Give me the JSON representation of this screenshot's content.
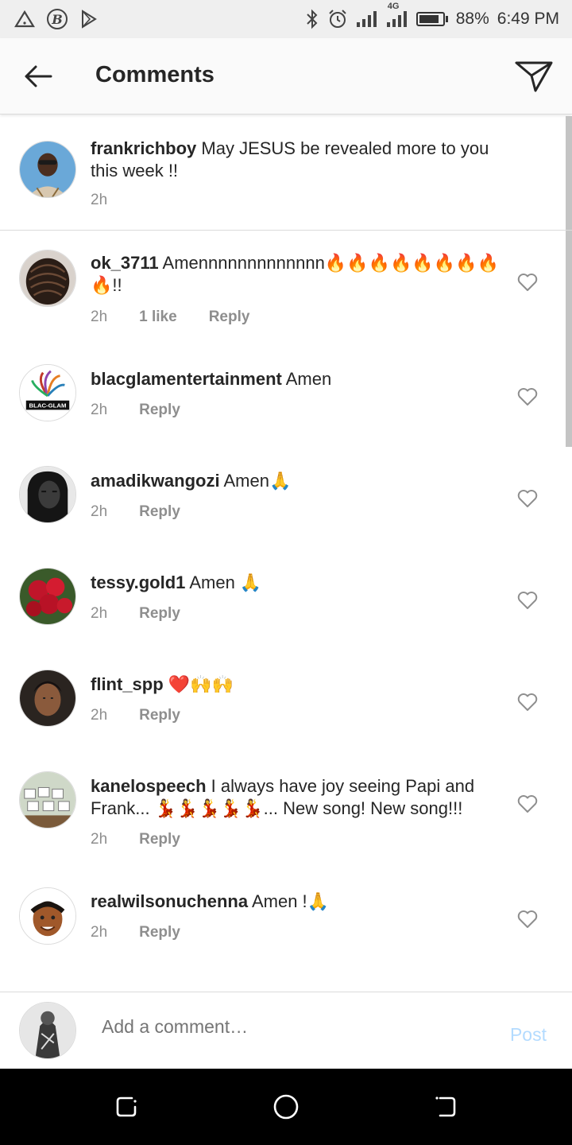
{
  "status_bar": {
    "network_label": "4G",
    "battery": "88%",
    "battery_level": 0.88,
    "time": "6:49 PM",
    "icons": [
      "alert-triangle-icon",
      "b-circle-icon",
      "play-store-icon",
      "bluetooth-icon",
      "alarm-icon",
      "signal-icon",
      "signal-4g-icon",
      "battery-icon"
    ]
  },
  "header": {
    "title": "Comments",
    "back_icon": "arrow-left-icon",
    "send_icon": "paper-plane-icon"
  },
  "caption": {
    "username": "frankrichboy",
    "text": "May JESUS be revealed more to you this week !!",
    "time": "2h"
  },
  "comments": [
    {
      "username": "ok_3711",
      "text": "Amennnnnnnnnnnnn🔥🔥🔥🔥🔥🔥🔥🔥🔥!!",
      "time": "2h",
      "likes": "1 like",
      "reply": "Reply"
    },
    {
      "username": "blacglamentertainment",
      "text": "Amen",
      "time": "2h",
      "reply": "Reply",
      "avatar_text": "BLAC-GLAM"
    },
    {
      "username": "amadikwangozi",
      "text": "Amen🙏",
      "time": "2h",
      "reply": "Reply"
    },
    {
      "username": "tessy.gold1",
      "text": "Amen 🙏",
      "time": "2h",
      "reply": "Reply"
    },
    {
      "username": "flint_spp",
      "text": "❤️🙌🙌",
      "time": "2h",
      "reply": "Reply"
    },
    {
      "username": "kanelospeech",
      "text": "I always have joy seeing Papi and Frank... 💃💃💃💃💃... New song! New song!!!",
      "time": "2h",
      "reply": "Reply"
    },
    {
      "username": "realwilsonuchenna",
      "text": "Amen !🙏",
      "time": "2h",
      "reply": "Reply"
    }
  ],
  "add_comment": {
    "placeholder": "Add a comment…",
    "post_label": "Post"
  },
  "nav_bar": {
    "icons": [
      "recents-icon",
      "home-icon",
      "back-nav-icon"
    ]
  }
}
